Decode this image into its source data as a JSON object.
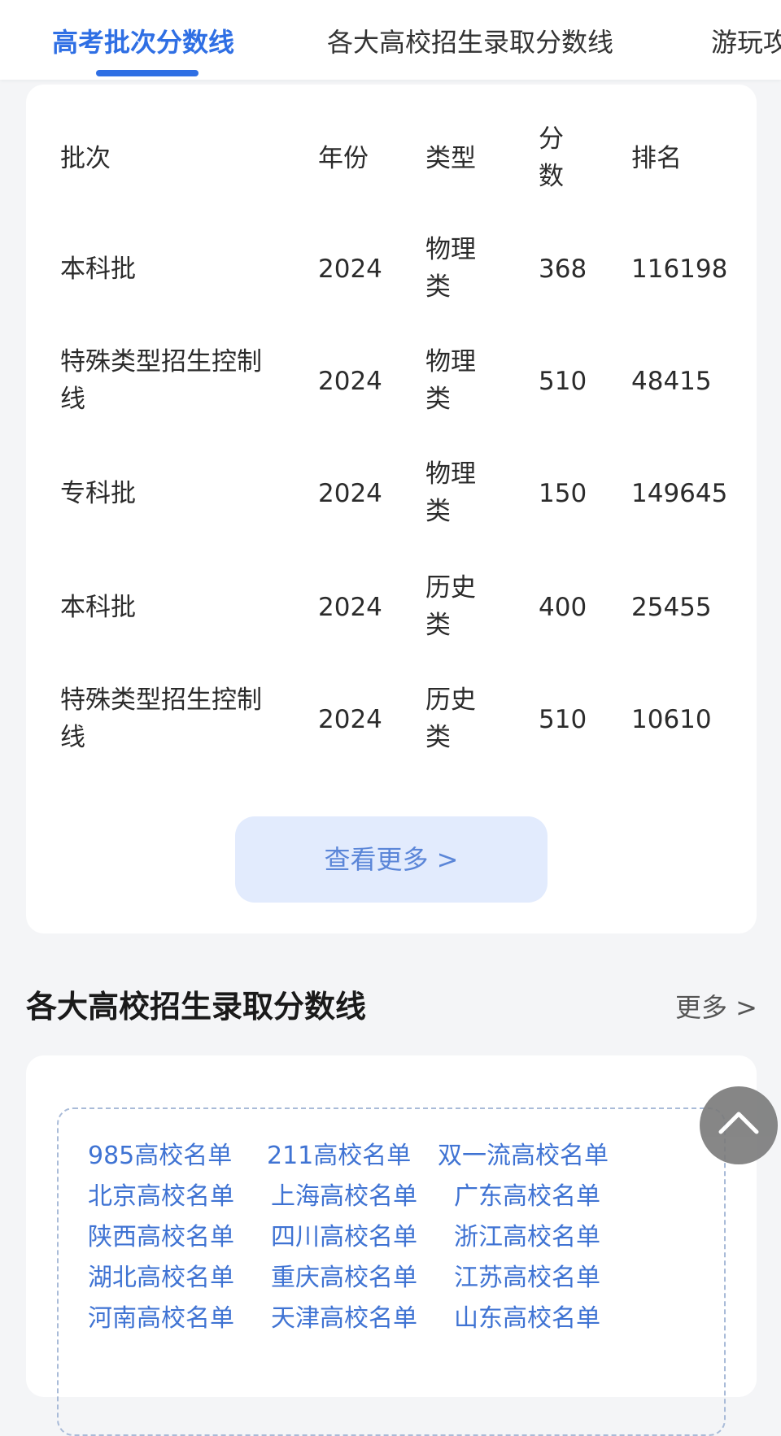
{
  "tabs": [
    {
      "label": "高考批次分数线",
      "active": true
    },
    {
      "label": "各大高校招生录取分数线",
      "active": false
    },
    {
      "label": "游玩攻",
      "active": false
    }
  ],
  "score_table": {
    "headers": {
      "batch": "批次",
      "year": "年份",
      "type": "类型",
      "score": "分数",
      "rank": "排名"
    },
    "rows": [
      {
        "batch": "本科批",
        "year": "2024",
        "type": "物理类",
        "score": "368",
        "rank": "116198"
      },
      {
        "batch": "特殊类型招生控制线",
        "year": "2024",
        "type": "物理类",
        "score": "510",
        "rank": "48415"
      },
      {
        "batch": "专科批",
        "year": "2024",
        "type": "物理类",
        "score": "150",
        "rank": "149645"
      },
      {
        "batch": "本科批",
        "year": "2024",
        "type": "历史类",
        "score": "400",
        "rank": "25455"
      },
      {
        "batch": "特殊类型招生控制线",
        "year": "2024",
        "type": "历史类",
        "score": "510",
        "rank": "10610"
      }
    ],
    "more_label": "查看更多 >"
  },
  "section": {
    "title": "各大高校招生录取分数线",
    "more_label": "更多 >"
  },
  "school_links": [
    "985高校名单",
    "211高校名单",
    "双一流高校名单",
    "北京高校名单",
    "上海高校名单",
    "广东高校名单",
    "陕西高校名单",
    "四川高校名单",
    "浙江高校名单",
    "湖北高校名单",
    "重庆高校名单",
    "江苏高校名单",
    "河南高校名单",
    "天津高校名单",
    "山东高校名单"
  ],
  "icons": {
    "scroll_top": "chevron-up-icon"
  },
  "colors": {
    "accent": "#2f6fe4",
    "link": "#3f73d3",
    "more_button_bg": "#e2ebfd"
  }
}
